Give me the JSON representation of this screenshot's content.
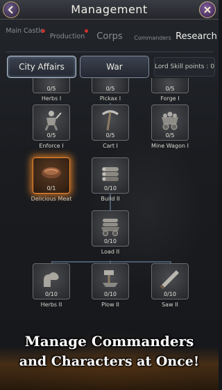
{
  "header": {
    "title": "Management"
  },
  "tabs": [
    {
      "label": "Main Castle",
      "active": false,
      "alert": true
    },
    {
      "label": "Production",
      "active": false,
      "alert": true
    },
    {
      "label": "Corps",
      "active": false,
      "alert": false
    },
    {
      "label": "Commanders",
      "active": false,
      "alert": false
    },
    {
      "label": "Research",
      "active": true,
      "alert": false
    }
  ],
  "subtabs": {
    "city_affairs": "City Affairs",
    "war": "War",
    "lord_skill_points": "Lord Skill points : 0"
  },
  "tree": {
    "row0": [
      {
        "name": "Herbs I",
        "count": "0/5"
      },
      {
        "name": "Pickax I",
        "count": "0/5"
      },
      {
        "name": "Forge I",
        "count": "0/5"
      }
    ],
    "row1": [
      {
        "name": "Enforce I",
        "count": "0/5",
        "icon": "warrior-icon"
      },
      {
        "name": "Cart I",
        "count": "0/5",
        "icon": "pickaxe-icon"
      },
      {
        "name": "Mine Wagon I",
        "count": "0/5",
        "icon": "mine-wagon-icon"
      }
    ],
    "row2": [
      {
        "name": "Delicious Meat",
        "count": "0/1",
        "icon": "meat-icon"
      },
      {
        "name": "Build II",
        "count": "0/10",
        "icon": "logs-icon"
      }
    ],
    "row3": [
      {
        "name": "Load II",
        "count": "0/10",
        "icon": "wagon-logs-icon"
      }
    ],
    "row4": [
      {
        "name": "Herbs II",
        "count": "0/10",
        "icon": "muscle-arm-icon"
      },
      {
        "name": "Plow II",
        "count": "0/10",
        "icon": "forge-hammer-icon"
      },
      {
        "name": "Saw II",
        "count": "0/10",
        "icon": "saw-icon"
      }
    ]
  },
  "banner": {
    "line1": "Manage Commanders",
    "line2": "and Characters at Once!"
  },
  "colors": {
    "accent_glow": "#f08a30",
    "connector": "#4a5a70",
    "alert_dot": "#d0302a"
  }
}
